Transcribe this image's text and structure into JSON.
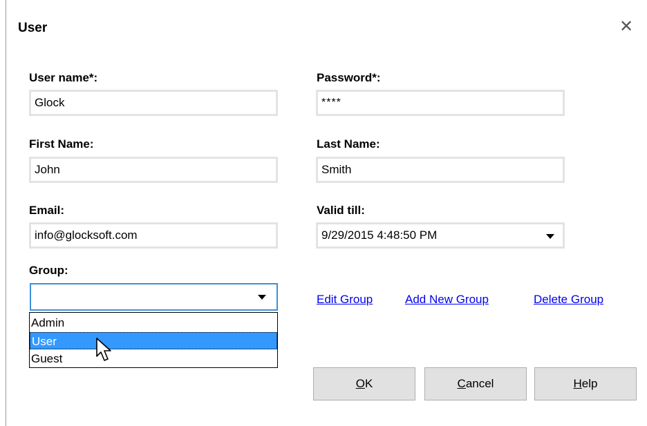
{
  "dialog": {
    "title": "User",
    "close_icon": "close-icon"
  },
  "form": {
    "username_label": "User name*:",
    "username_value": "Glock",
    "password_label": "Password*:",
    "password_value": "****",
    "firstname_label": "First Name:",
    "firstname_value": "John",
    "lastname_label": "Last Name:",
    "lastname_value": "Smith",
    "email_label": "Email:",
    "email_value": "info@glocksoft.com",
    "validtill_label": "Valid till:",
    "validtill_value": "9/29/2015 4:48:50 PM",
    "group_label": "Group:",
    "group_value": "",
    "group_options": [
      "Admin",
      "User",
      "Guest"
    ],
    "group_selected": "User"
  },
  "links": {
    "edit_group": "Edit Group",
    "add_new_group": "Add New Group",
    "delete_group": "Delete Group"
  },
  "buttons": {
    "ok_mnemonic": "O",
    "ok_rest": "K",
    "cancel_mnemonic": "C",
    "cancel_rest": "ancel",
    "help_mnemonic": "H",
    "help_rest": "elp"
  },
  "colors": {
    "selection": "#3399ff",
    "link": "#0000ee",
    "focus_border": "#3c8fd9"
  }
}
